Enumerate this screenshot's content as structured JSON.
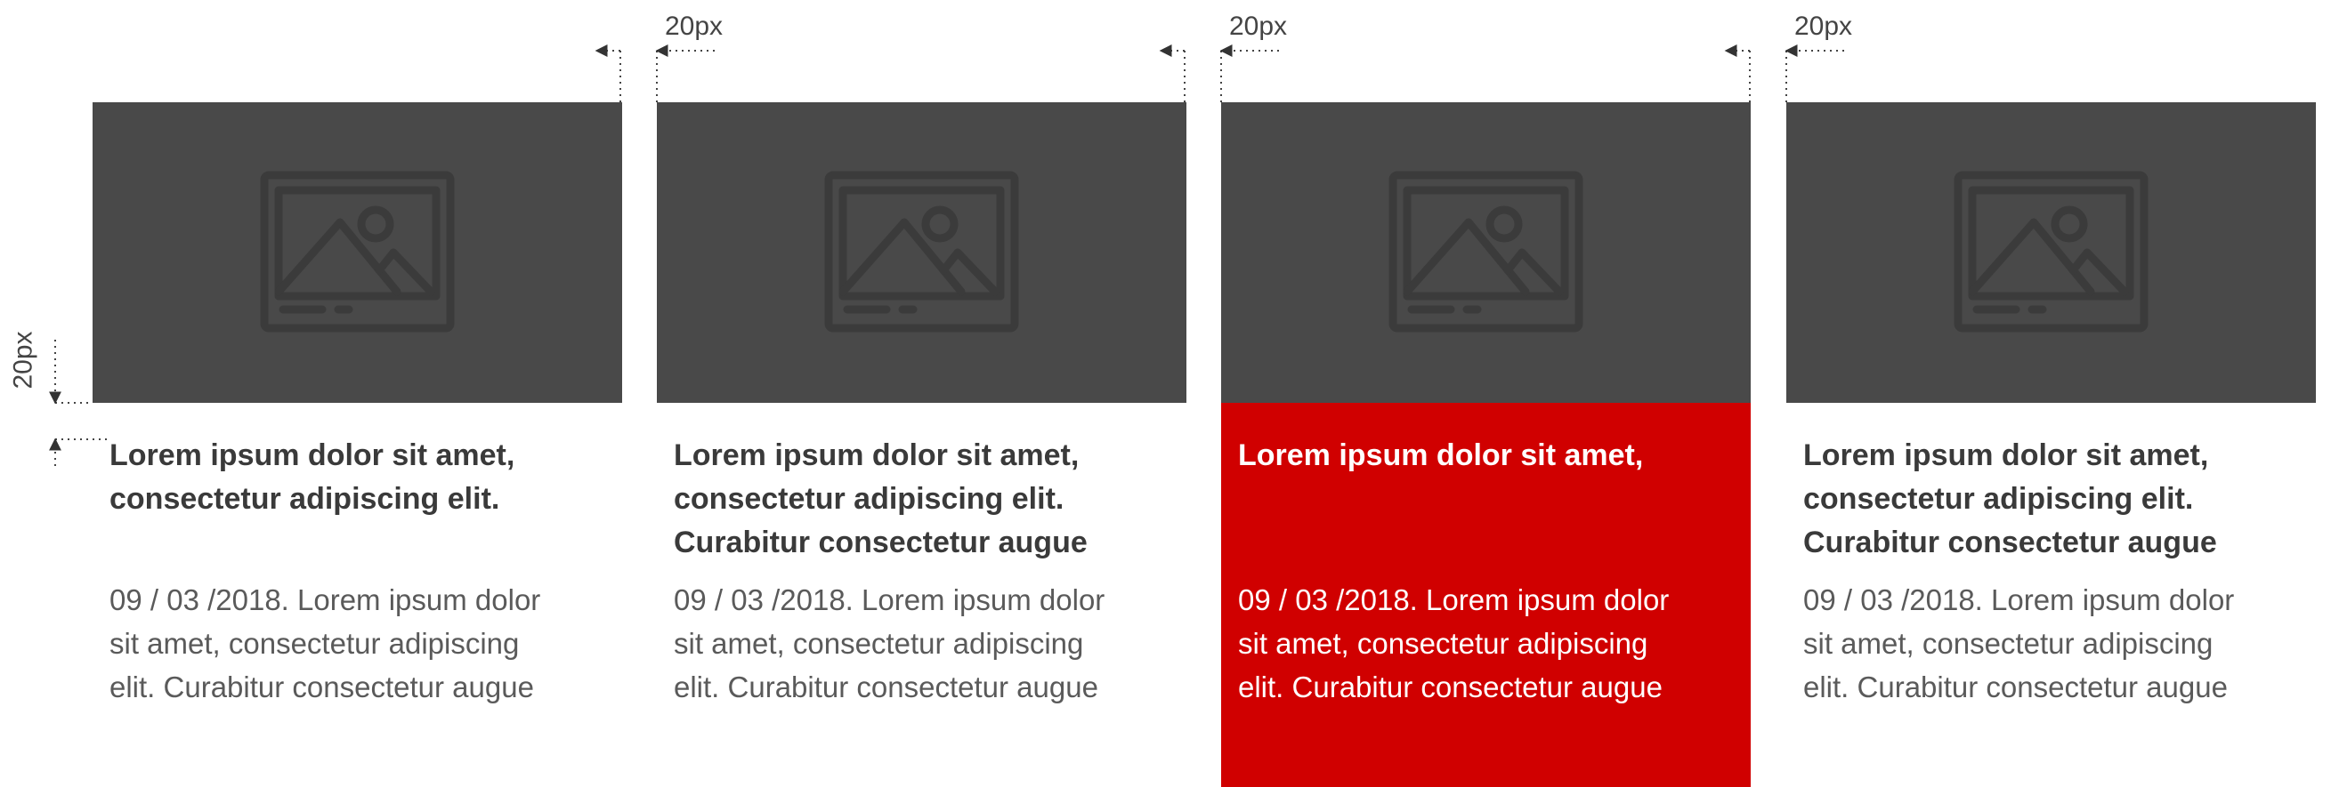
{
  "annotations": {
    "spacing_label": "20px"
  },
  "cards": [
    {
      "title_lines": [
        "Lorem ipsum dolor sit amet,",
        "consectetur adipiscing elit."
      ],
      "desc_lines": [
        "09 / 03 /2018. Lorem ipsum dolor",
        "sit amet, consectetur adipiscing",
        "elit. Curabitur consectetur augue"
      ]
    },
    {
      "title_lines": [
        "Lorem ipsum dolor sit amet,",
        "consectetur adipiscing elit.",
        "Curabitur consectetur augue"
      ],
      "desc_lines": [
        "09 / 03 /2018. Lorem ipsum dolor",
        "sit amet, consectetur adipiscing",
        "elit. Curabitur consectetur augue"
      ]
    },
    {
      "title_lines": [
        "Lorem ipsum dolor sit amet,"
      ],
      "desc_lines": [
        "09 / 03 /2018. Lorem ipsum dolor",
        "sit amet, consectetur adipiscing",
        "elit. Curabitur consectetur augue"
      ],
      "highlighted": true
    },
    {
      "title_lines": [
        "Lorem ipsum dolor sit amet,",
        "consectetur adipiscing elit.",
        "Curabitur consectetur augue"
      ],
      "desc_lines": [
        "09 / 03 /2018. Lorem ipsum dolor",
        "sit amet, consectetur adipiscing",
        "elit. Curabitur consectetur augue"
      ]
    }
  ],
  "colors": {
    "thumbnail_bg": "#494949",
    "icon": "#3b3b3b",
    "highlight_bg": "#d00000",
    "text": "#3d3d3d"
  },
  "icons": {
    "thumbnail": "image-placeholder-icon"
  }
}
